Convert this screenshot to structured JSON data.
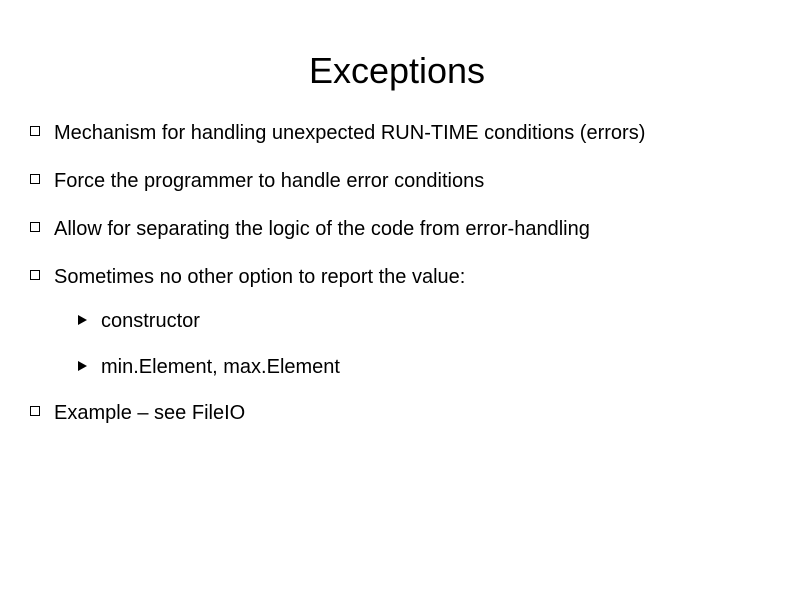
{
  "title": "Exceptions",
  "bullets": [
    {
      "text": "Mechanism for handling unexpected RUN-TIME conditions (errors)"
    },
    {
      "text": "Force the programmer to handle error conditions"
    },
    {
      "text": "Allow for separating the logic of the code from error-handling"
    },
    {
      "text": "Sometimes no other option to report the value:"
    },
    {
      "text": "Example – see FileIO"
    }
  ],
  "subbullets": [
    {
      "text": "constructor"
    },
    {
      "text": "min.Element, max.Element"
    }
  ]
}
